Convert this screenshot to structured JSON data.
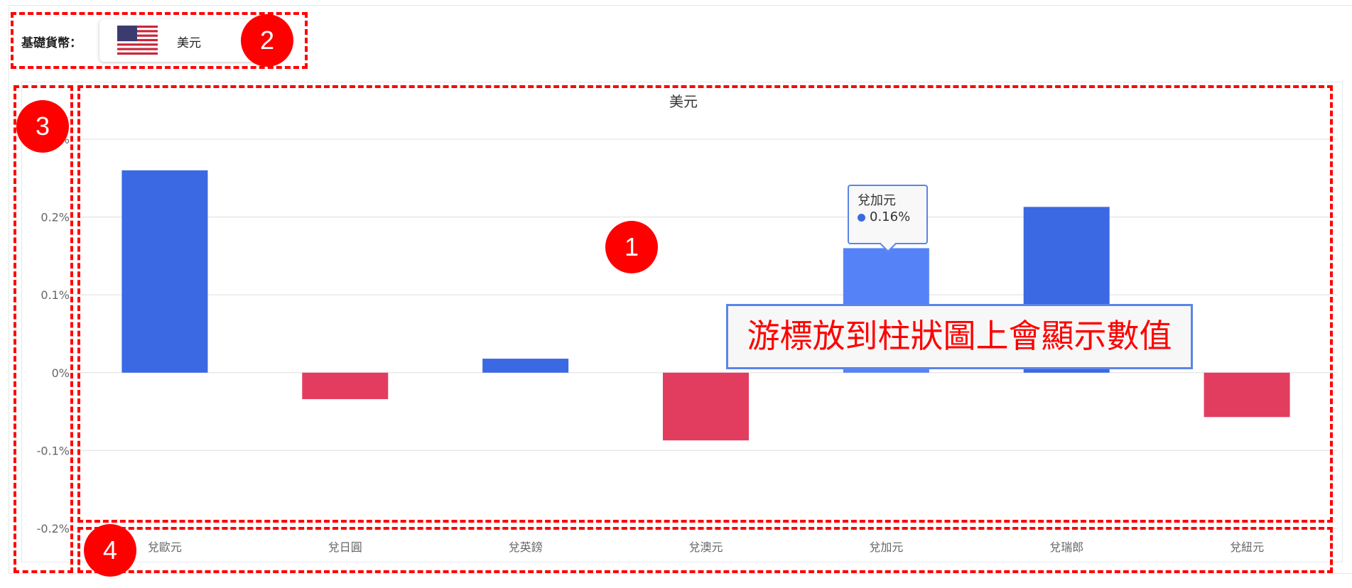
{
  "header": {
    "base_currency_label": "基礎貨幣：",
    "selected_currency": "美元",
    "selected_currency_flag": "us-flag-icon"
  },
  "tooltip": {
    "name": "兌加元",
    "value": "0.16%"
  },
  "annotation_note": "游標放到柱狀圖上會顯示數值",
  "annotation_markers": [
    "1",
    "2",
    "3",
    "4"
  ],
  "colors": {
    "positive": "#3b68e3",
    "positive_hover": "#5582f7",
    "negative": "#e23d5f",
    "grid": "#e8e8e8",
    "axis_text": "#666666",
    "annotation": "#ff0000"
  },
  "chart_data": {
    "type": "bar",
    "title": "美元",
    "categories": [
      "兌歐元",
      "兌日圓",
      "兌英鎊",
      "兌澳元",
      "兌加元",
      "兌瑞郎",
      "兌紐元"
    ],
    "values": [
      0.26,
      -0.034,
      0.018,
      -0.087,
      0.16,
      0.213,
      -0.057
    ],
    "unit": "%",
    "xlabel": "",
    "ylabel": "",
    "ylim": [
      -0.2,
      0.3
    ],
    "yticks": [
      -0.2,
      -0.1,
      0,
      0.1,
      0.2,
      0.3
    ],
    "ytick_labels": [
      "-0.2%",
      "-0.1%",
      "0%",
      "0.1%",
      "0.2%",
      "0.3%"
    ],
    "grid": true,
    "legend": "none",
    "highlighted_category": "兌加元"
  }
}
